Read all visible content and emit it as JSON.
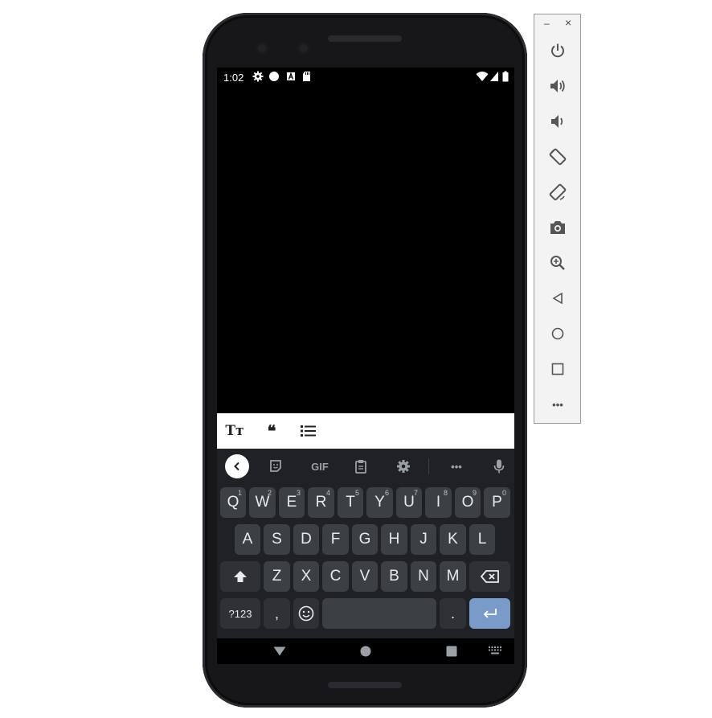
{
  "status_bar": {
    "time": "1:02",
    "left_icons": [
      "gear-icon",
      "circle-icon",
      "a-icon",
      "sd-card-icon"
    ],
    "right_icons": [
      "wifi-icon",
      "signal-icon",
      "battery-icon"
    ]
  },
  "format_toolbar": {
    "items": [
      {
        "icon": "text-size-icon",
        "label": "Tт"
      },
      {
        "icon": "quote-icon",
        "label": "❝"
      },
      {
        "icon": "bullet-list-icon"
      }
    ]
  },
  "keyboard": {
    "suggestion_strip": {
      "items": [
        "back-icon",
        "sticker-icon",
        "gif-icon",
        "clipboard-icon",
        "settings-icon",
        "more-icon",
        "mic-icon"
      ],
      "gif_label": "GIF",
      "more_label": "•••"
    },
    "row1": [
      {
        "key": "Q",
        "hint": "1"
      },
      {
        "key": "W",
        "hint": "2"
      },
      {
        "key": "E",
        "hint": "3"
      },
      {
        "key": "R",
        "hint": "4"
      },
      {
        "key": "T",
        "hint": "5"
      },
      {
        "key": "Y",
        "hint": "6"
      },
      {
        "key": "U",
        "hint": "7"
      },
      {
        "key": "I",
        "hint": "8"
      },
      {
        "key": "O",
        "hint": "9"
      },
      {
        "key": "P",
        "hint": "0"
      }
    ],
    "row2": [
      "A",
      "S",
      "D",
      "F",
      "G",
      "H",
      "J",
      "K",
      "L"
    ],
    "row3": [
      "Z",
      "X",
      "C",
      "V",
      "B",
      "N",
      "M"
    ],
    "symbols_label": "?123",
    "comma_label": ",",
    "period_label": ".",
    "enter_icon": "enter-icon"
  },
  "nav_bar": {
    "items": [
      "back-triangle-icon",
      "home-circle-icon",
      "recents-square-icon",
      "keyboard-icon"
    ]
  },
  "emulator_panel": {
    "window_controls": {
      "minimize": "–",
      "close": "×"
    },
    "buttons": [
      "power-icon",
      "volume-up-icon",
      "volume-down-icon",
      "rotate-left-icon",
      "rotate-right-icon",
      "camera-icon",
      "zoom-icon",
      "back-icon",
      "home-icon",
      "overview-icon",
      "more-icon"
    ],
    "more_label": "•••"
  }
}
